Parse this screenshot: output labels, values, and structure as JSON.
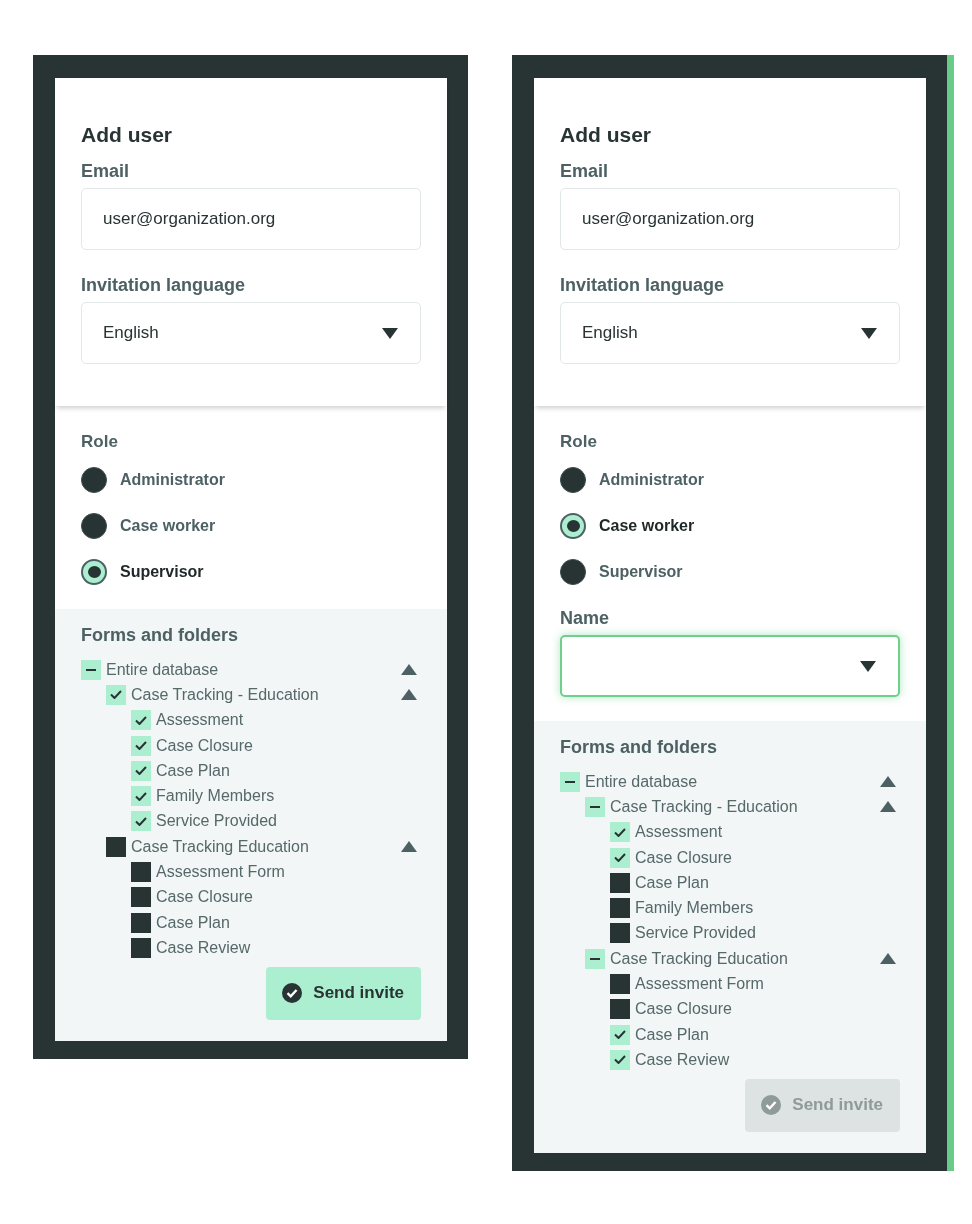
{
  "panels": [
    {
      "title": "Add user",
      "email": {
        "label": "Email",
        "value": "user@organization.org"
      },
      "language": {
        "label": "Invitation language",
        "value": "English"
      },
      "role": {
        "label": "Role",
        "options": [
          {
            "label": "Administrator",
            "selected": false
          },
          {
            "label": "Case worker",
            "selected": false
          },
          {
            "label": "Supervisor",
            "selected": true
          }
        ]
      },
      "forms": {
        "heading": "Forms and folders",
        "tree": [
          {
            "label": "Entire database",
            "checked": true,
            "indeterminate": true,
            "expanded": true,
            "children": [
              {
                "label": "Case Tracking - Education",
                "checked": true,
                "indeterminate": false,
                "expanded": true,
                "children": [
                  {
                    "label": "Assessment",
                    "checked": true
                  },
                  {
                    "label": "Case Closure",
                    "checked": true
                  },
                  {
                    "label": "Case Plan",
                    "checked": true
                  },
                  {
                    "label": "Family Members",
                    "checked": true
                  },
                  {
                    "label": "Service Provided",
                    "checked": true
                  }
                ]
              },
              {
                "label": "Case Tracking Education",
                "checked": false,
                "indeterminate": false,
                "expanded": true,
                "children": [
                  {
                    "label": "Assessment Form",
                    "checked": false
                  },
                  {
                    "label": "Case Closure",
                    "checked": false
                  },
                  {
                    "label": "Case Plan",
                    "checked": false
                  },
                  {
                    "label": "Case Review",
                    "checked": false
                  }
                ]
              }
            ]
          }
        ]
      },
      "send_button": {
        "label": "Send invite",
        "disabled": false
      },
      "highlighted": false
    },
    {
      "title": "Add user",
      "email": {
        "label": "Email",
        "value": "user@organization.org"
      },
      "language": {
        "label": "Invitation language",
        "value": "English"
      },
      "role": {
        "label": "Role",
        "options": [
          {
            "label": "Administrator",
            "selected": false
          },
          {
            "label": "Case worker",
            "selected": true
          },
          {
            "label": "Supervisor",
            "selected": false
          }
        ]
      },
      "name_field": {
        "label": "Name",
        "focused": true
      },
      "forms": {
        "heading": "Forms and folders",
        "tree": [
          {
            "label": "Entire database",
            "checked": true,
            "indeterminate": true,
            "expanded": true,
            "children": [
              {
                "label": "Case Tracking - Education",
                "checked": true,
                "indeterminate": true,
                "expanded": true,
                "children": [
                  {
                    "label": "Assessment",
                    "checked": true
                  },
                  {
                    "label": "Case Closure",
                    "checked": true
                  },
                  {
                    "label": "Case Plan",
                    "checked": false
                  },
                  {
                    "label": "Family Members",
                    "checked": false
                  },
                  {
                    "label": "Service Provided",
                    "checked": false
                  }
                ]
              },
              {
                "label": "Case Tracking Education",
                "checked": true,
                "indeterminate": true,
                "expanded": true,
                "children": [
                  {
                    "label": "Assessment Form",
                    "checked": false
                  },
                  {
                    "label": "Case Closure",
                    "checked": false
                  },
                  {
                    "label": "Case Plan",
                    "checked": true
                  },
                  {
                    "label": "Case Review",
                    "checked": true
                  }
                ]
              }
            ]
          }
        ]
      },
      "send_button": {
        "label": "Send invite",
        "disabled": true
      },
      "highlighted": true
    }
  ]
}
